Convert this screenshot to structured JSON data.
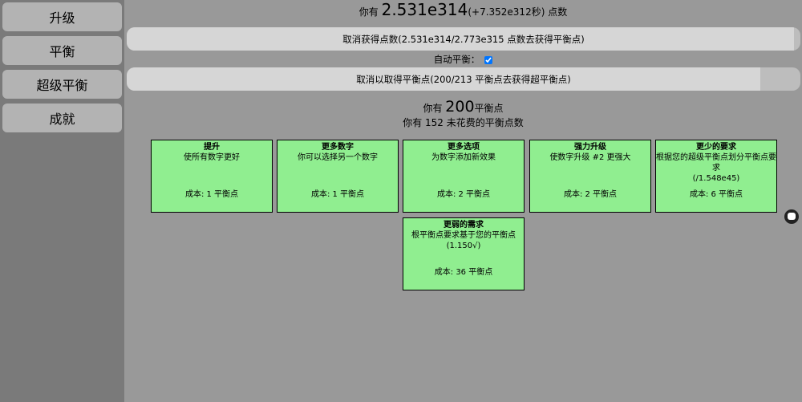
{
  "sidebar": {
    "items": [
      {
        "label": "升级"
      },
      {
        "label": "平衡"
      },
      {
        "label": "超级平衡"
      },
      {
        "label": "成就"
      }
    ]
  },
  "header": {
    "prefix": "你有",
    "points": "2.531e314",
    "rate": "(+7.352e312秒)",
    "suffix": "点数"
  },
  "balance_reset": {
    "label": "取消获得点数(2.531e314/2.773e315 点数去获得平衡点)",
    "progress": 0.99
  },
  "auto_balance": {
    "label": "自动平衡：",
    "checked": true
  },
  "super_reset": {
    "label": "取消以取得平衡点(200/213 平衡点去获得超平衡点)",
    "progress": 0.94
  },
  "balance_info": {
    "prefix": "你有",
    "amount": "200",
    "unit": "平衡点",
    "unspent_line": "你有 152 未花费的平衡点数"
  },
  "upgrades": [
    {
      "title": "提升",
      "desc": "使所有数字更好",
      "extra": "",
      "cost": "成本: 1 平衡点"
    },
    {
      "title": "更多数字",
      "desc": "你可以选择另一个数字",
      "extra": "",
      "cost": "成本: 1 平衡点"
    },
    {
      "title": "更多选项",
      "desc": "为数字添加新效果",
      "extra": "",
      "cost": "成本: 2 平衡点"
    },
    {
      "title": "强力升级",
      "desc": "使数字升级 #2 更强大",
      "extra": "",
      "cost": "成本: 2 平衡点"
    },
    {
      "title": "更少的要求",
      "desc": "根据您的超级平衡点划分平衡点要求",
      "extra": "(/1.548e45)",
      "cost": "成本: 6 平衡点"
    },
    {
      "title": "更弱的需求",
      "desc": "根平衡点要求基于您的平衡点",
      "extra": "(1.150√)",
      "cost": "成本: 36 平衡点"
    }
  ],
  "colors": {
    "background": "#999999",
    "sidebar": "#7a7a7a",
    "nav_button": "#b3b3b3",
    "card": "#90ee90"
  }
}
